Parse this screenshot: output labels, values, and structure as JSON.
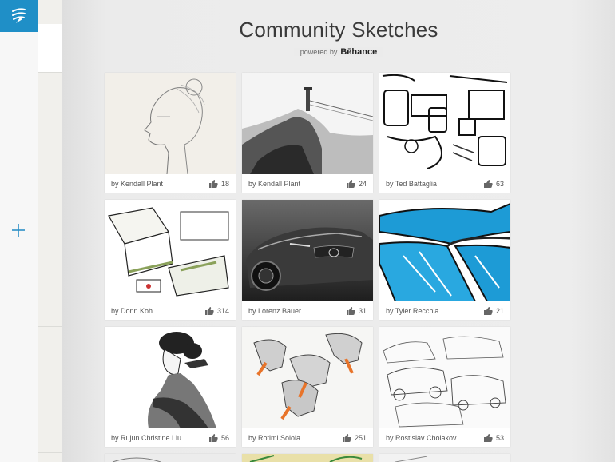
{
  "app": {
    "logo_icon": "sketch-app-logo-icon",
    "accent": "#1f8fc7"
  },
  "header": {
    "title": "Community Sketches",
    "powered_label": "powered by",
    "powered_brand": "Bēhance"
  },
  "cards": [
    {
      "author": "by Kendall Plant",
      "likes": "18"
    },
    {
      "author": "by Kendall Plant",
      "likes": "24"
    },
    {
      "author": "by Ted Battaglia",
      "likes": "63"
    },
    {
      "author": "by Donn Koh",
      "likes": "314"
    },
    {
      "author": "by Lorenz Bauer",
      "likes": "31"
    },
    {
      "author": "by Tyler Recchia",
      "likes": "21"
    },
    {
      "author": "by Rujun Christine Liu",
      "likes": "56"
    },
    {
      "author": "by Rotimi Solola",
      "likes": "251"
    },
    {
      "author": "by Rostislav Cholakov",
      "likes": "53"
    }
  ]
}
